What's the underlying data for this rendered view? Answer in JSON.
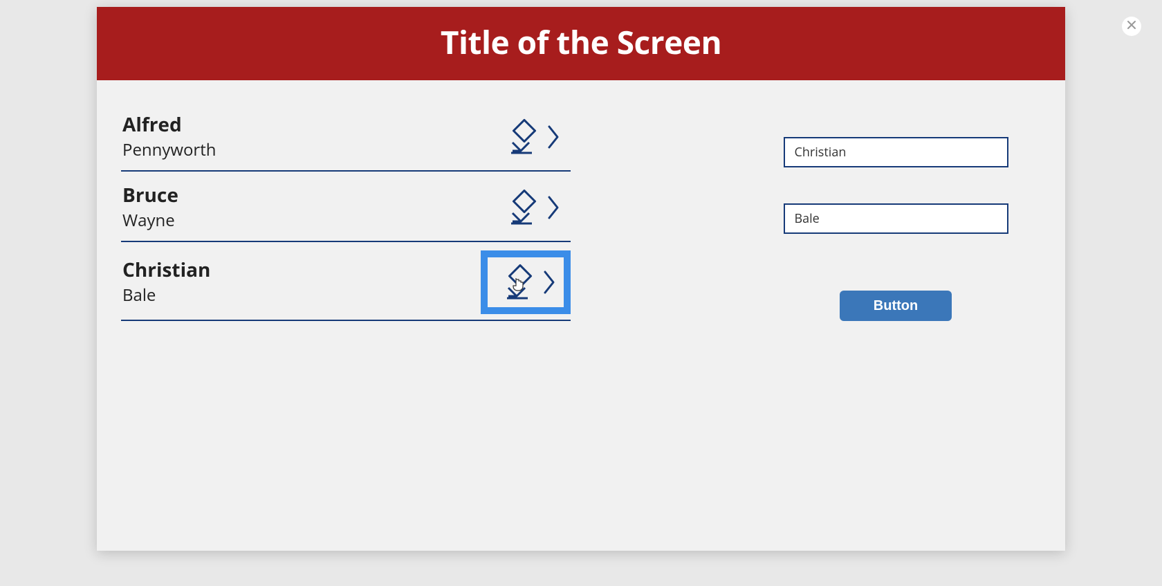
{
  "header": {
    "title": "Title of the Screen"
  },
  "list": {
    "items": [
      {
        "first": "Alfred",
        "last": "Pennyworth",
        "selected": false
      },
      {
        "first": "Bruce",
        "last": "Wayne",
        "selected": false
      },
      {
        "first": "Christian",
        "last": "Bale",
        "selected": true
      }
    ]
  },
  "form": {
    "first_value": "Christian",
    "last_value": "Bale",
    "button_label": "Button"
  },
  "colors": {
    "header_bg": "#a71d1d",
    "accent": "#163a78",
    "highlight": "#3b8de8",
    "button": "#3b77b9"
  }
}
